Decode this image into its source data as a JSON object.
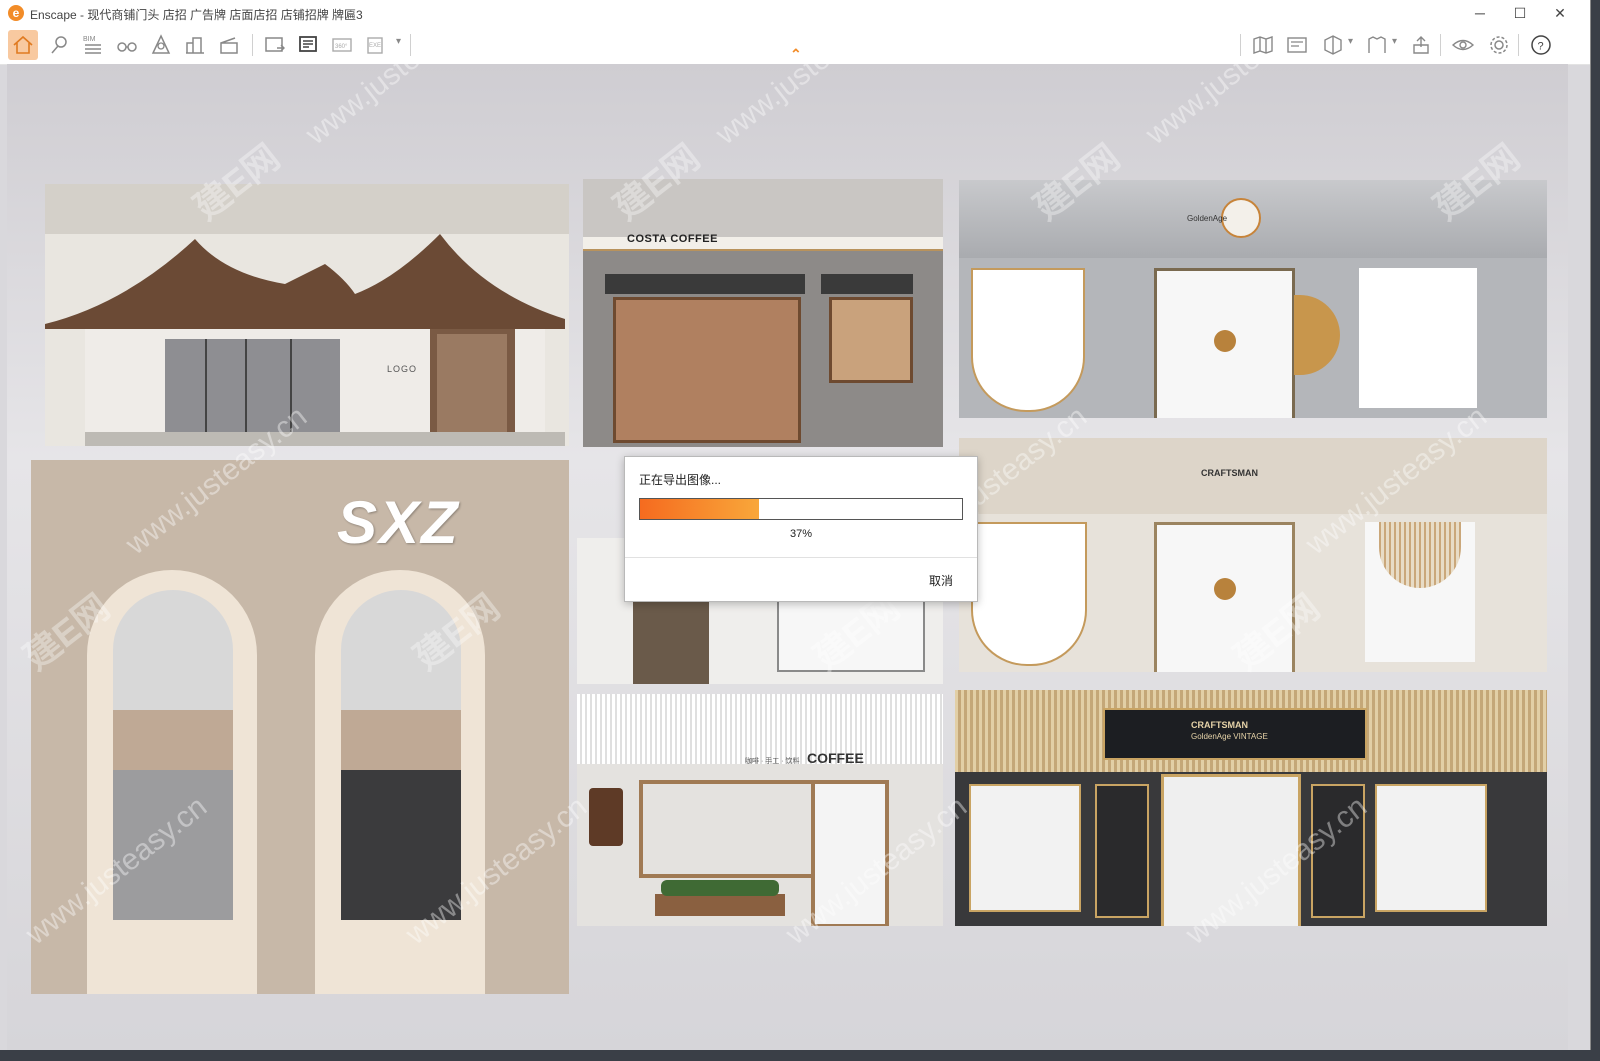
{
  "window": {
    "title": "Enscape - 现代商铺门头 店招 广告牌 店面店招 店铺招牌 牌匾3",
    "minimize": "─",
    "maximize": "☐",
    "close": "✕"
  },
  "toolbar": {
    "bim_label": "BIM",
    "pano_label": "360°",
    "exe_label": "EXE"
  },
  "scene": {
    "logo_text": "LOGO",
    "sxz_sign": "SXZ",
    "costa_sign": "COSTA COFFEE",
    "coffee_sign": "COFFEE",
    "coffee_sign_prefix": "咖啡 · 手工 · 饮料",
    "golden_age_sign": "GoldenAge",
    "craftsman_sign": "CRAFTSMAN",
    "craftsman_sub": "GoldenAge VINTAGE"
  },
  "export_dialog": {
    "message": "正在导出图像...",
    "progress_text": "37%",
    "progress_fraction": 0.37,
    "cancel_label": "取消"
  },
  "watermarks": {
    "site": "www.justeasy.cn",
    "brand": "建E网"
  },
  "colors": {
    "accent": "#f28c28",
    "progress_start": "#f56b1f",
    "progress_end": "#f9a73a"
  }
}
